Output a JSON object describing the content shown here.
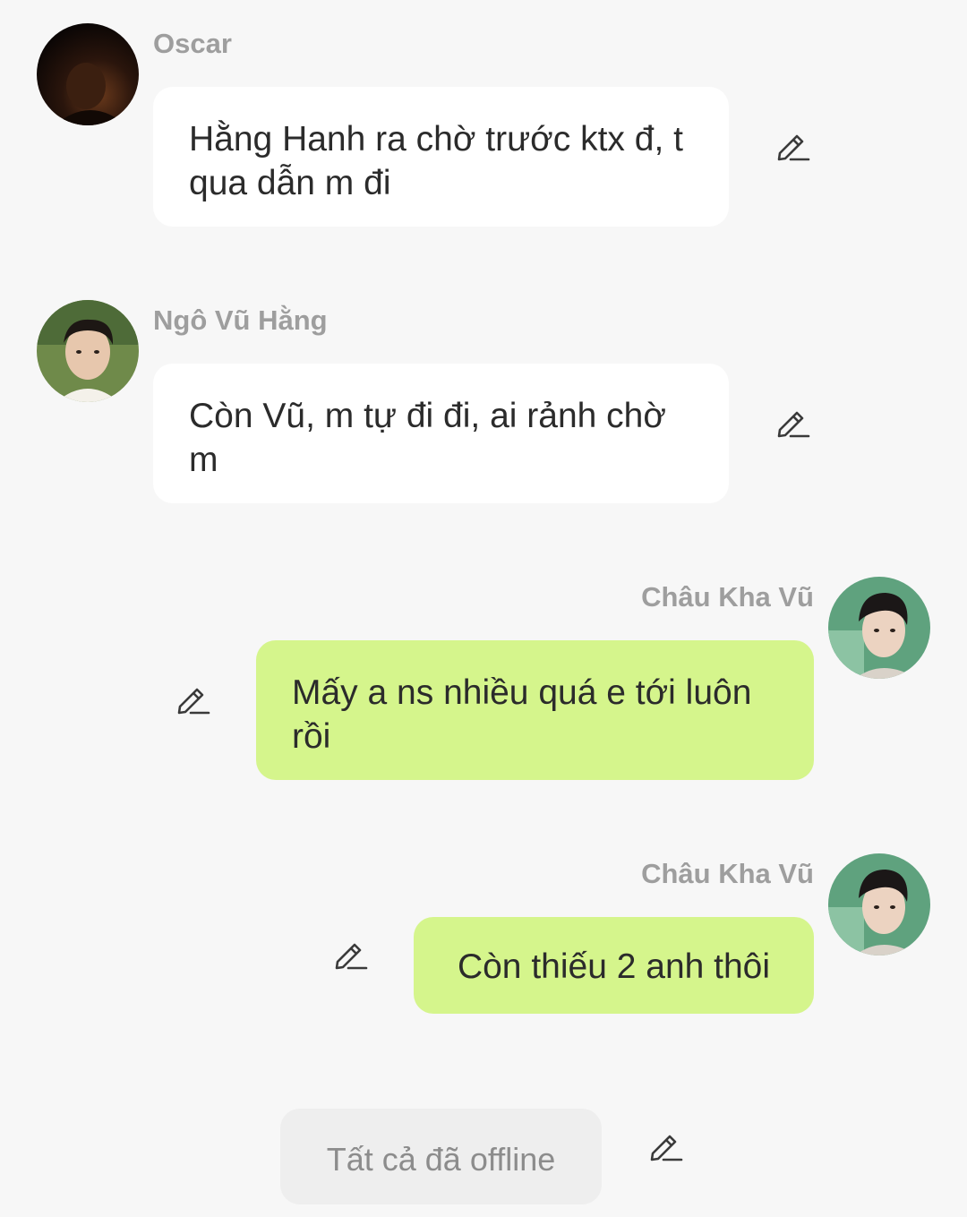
{
  "messages": [
    {
      "sender": "Oscar",
      "text": "Hằng Hanh ra chờ trước ktx đ, t qua dẫn m đi",
      "avatar": "avatar-oscar",
      "direction": "incoming"
    },
    {
      "sender": "Ngô Vũ Hằng",
      "text": "Còn Vũ, m tự đi đi, ai rảnh chờ m",
      "avatar": "avatar-ngo-vu-hang",
      "direction": "incoming"
    },
    {
      "sender": "Châu Kha Vũ",
      "text": "Mấy a ns nhiều quá e tới luôn rồi",
      "avatar": "avatar-chau-kha-vu",
      "direction": "outgoing"
    },
    {
      "sender": "Châu Kha Vũ",
      "text": "Còn thiếu 2 anh thôi",
      "avatar": "avatar-chau-kha-vu",
      "direction": "outgoing"
    }
  ],
  "system_message": "Tất cả đã offline",
  "icons": {
    "edit": "pencil-edit-icon"
  },
  "colors": {
    "background": "#f7f7f7",
    "incoming_bubble": "#ffffff",
    "outgoing_bubble": "#d5f58c",
    "system_bubble": "#eeeeee",
    "sender_name": "#9e9e9e"
  }
}
